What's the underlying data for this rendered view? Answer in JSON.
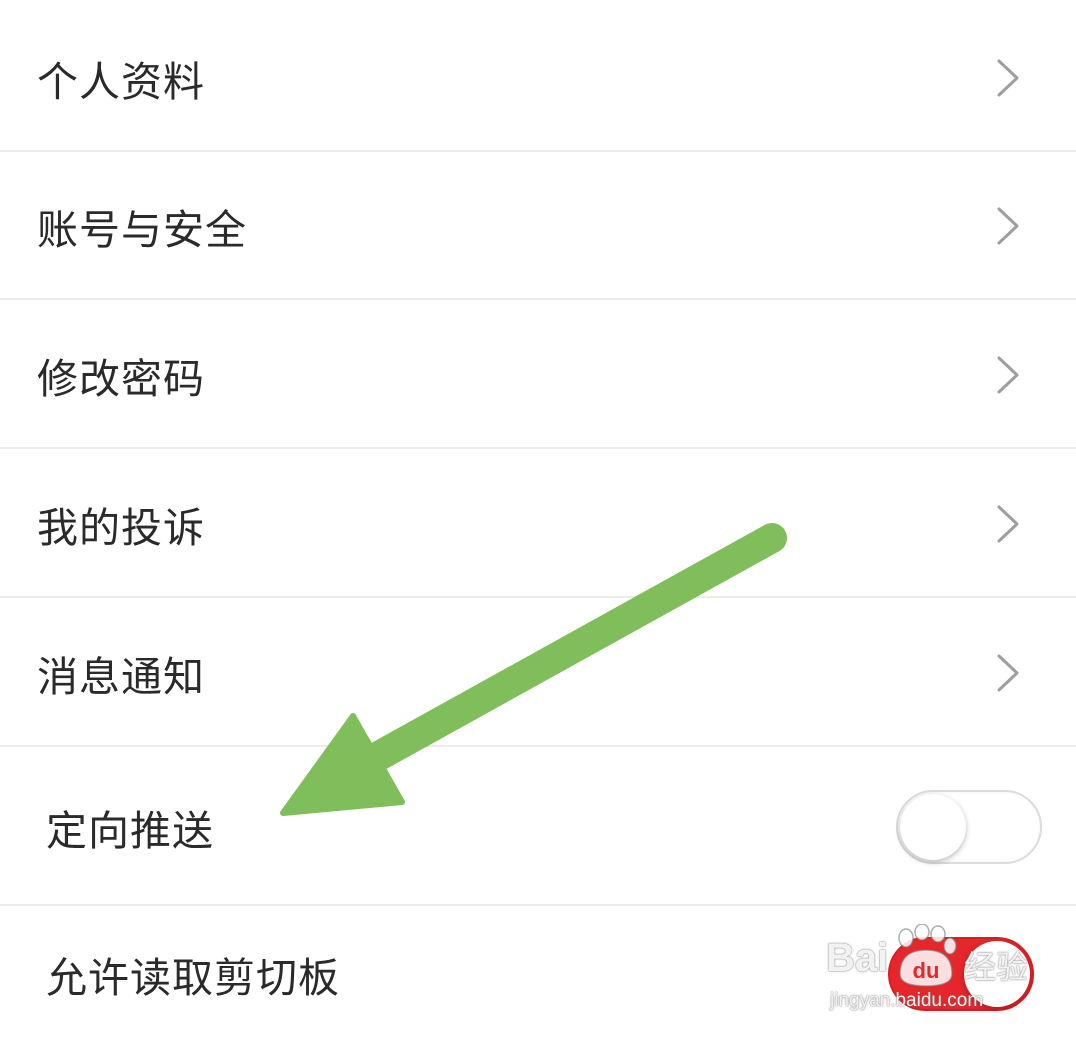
{
  "settings": {
    "items": [
      {
        "label": "个人资料",
        "control": "chevron"
      },
      {
        "label": "账号与安全",
        "control": "chevron"
      },
      {
        "label": "修改密码",
        "control": "chevron"
      },
      {
        "label": "我的投诉",
        "control": "chevron"
      },
      {
        "label": "消息通知",
        "control": "chevron"
      },
      {
        "label": "定向推送",
        "control": "toggle",
        "toggle_state": "off"
      },
      {
        "label": "允许读取剪切板",
        "control": "toggle",
        "toggle_state": "on"
      }
    ]
  },
  "colors": {
    "text": "#2a2a2a",
    "chevron": "#9e9e9e",
    "divider": "#ececec",
    "toggle_on": "#e5262b",
    "toggle_off_border": "#dcdcdc",
    "annotation_arrow": "#7fbe5a"
  },
  "annotation": {
    "icon": "arrow-pointing-icon"
  },
  "watermark": {
    "brand": "Bai",
    "brand_paw": "du",
    "product": "经验",
    "url": "jingyan.baidu.com"
  }
}
